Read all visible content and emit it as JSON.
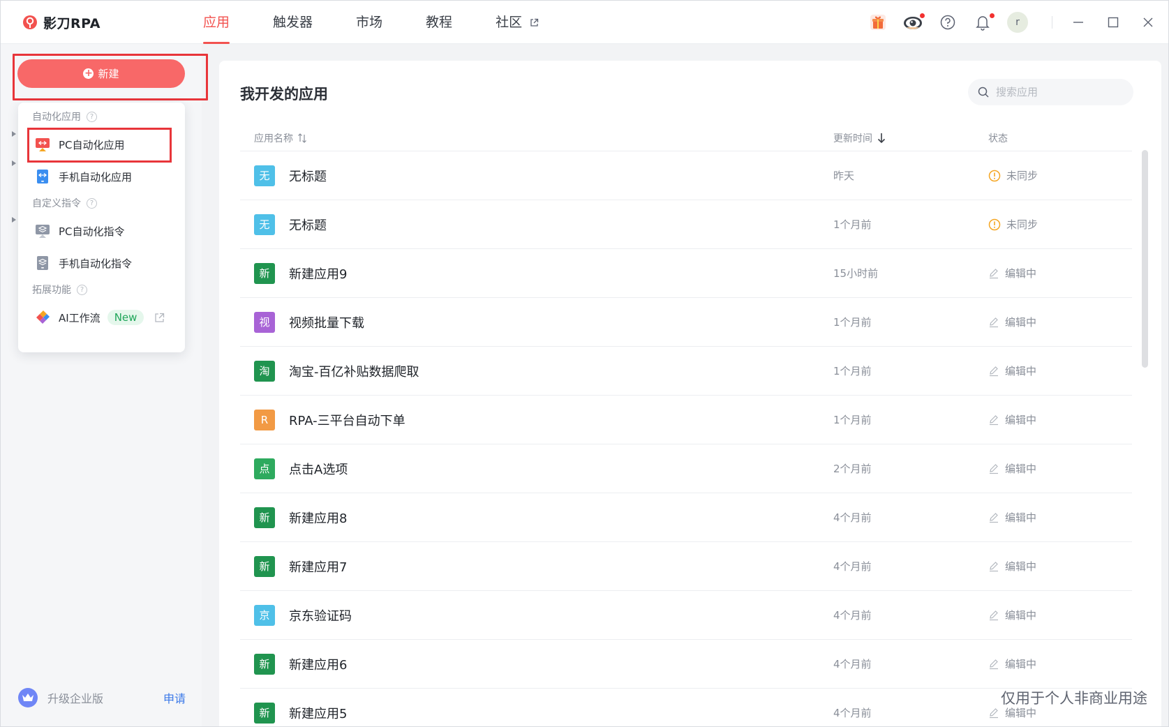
{
  "app": {
    "name": "影刀RPA",
    "brand_color": "#f2524f"
  },
  "nav": {
    "tabs": [
      {
        "label": "应用",
        "active": true
      },
      {
        "label": "触发器",
        "active": false
      },
      {
        "label": "市场",
        "active": false
      },
      {
        "label": "教程",
        "active": false
      },
      {
        "label": "社区",
        "active": false,
        "external": true
      }
    ]
  },
  "header": {
    "icons": [
      "gift-icon",
      "eye-icon",
      "help-icon",
      "bell-icon"
    ],
    "avatar_initial": "r"
  },
  "sidebar": {
    "new_button_label": "新建",
    "upgrade_text": "升级企业版",
    "upgrade_link": "申请"
  },
  "dropdown": {
    "sections": [
      {
        "title": "自动化应用",
        "items": [
          {
            "label": "PC自动化应用",
            "icon": "pc-app-icon"
          },
          {
            "label": "手机自动化应用",
            "icon": "mobile-app-icon"
          }
        ]
      },
      {
        "title": "自定义指令",
        "items": [
          {
            "label": "PC自动化指令",
            "icon": "pc-command-icon"
          },
          {
            "label": "手机自动化指令",
            "icon": "mobile-command-icon"
          }
        ]
      },
      {
        "title": "拓展功能",
        "items": [
          {
            "label": "AI工作流",
            "icon": "ai-workflow-icon",
            "badge": "New"
          }
        ]
      }
    ]
  },
  "main": {
    "title": "我开发的应用",
    "search_placeholder": "搜索应用",
    "columns": {
      "name": "应用名称",
      "time": "更新时间",
      "status": "状态"
    },
    "rows": [
      {
        "icon_char": "无",
        "icon_color": "#4fc0e8",
        "name": "无标题",
        "time": "昨天",
        "status": "未同步",
        "status_type": "warn"
      },
      {
        "icon_char": "无",
        "icon_color": "#4fc0e8",
        "name": "无标题",
        "time": "1个月前",
        "status": "未同步",
        "status_type": "warn"
      },
      {
        "icon_char": "新",
        "icon_color": "#20944f",
        "name": "新建应用9",
        "time": "15小时前",
        "status": "编辑中",
        "status_type": "edit"
      },
      {
        "icon_char": "视",
        "icon_color": "#a863d6",
        "name": "视频批量下载",
        "time": "1个月前",
        "status": "编辑中",
        "status_type": "edit"
      },
      {
        "icon_char": "淘",
        "icon_color": "#20944f",
        "name": "淘宝-百亿补贴数据爬取",
        "time": "1个月前",
        "status": "编辑中",
        "status_type": "edit"
      },
      {
        "icon_char": "R",
        "icon_color": "#f29a44",
        "name": "RPA-三平台自动下单",
        "time": "1个月前",
        "status": "编辑中",
        "status_type": "edit"
      },
      {
        "icon_char": "点",
        "icon_color": "#2eaa5e",
        "name": "点击A选项",
        "time": "2个月前",
        "status": "编辑中",
        "status_type": "edit"
      },
      {
        "icon_char": "新",
        "icon_color": "#20944f",
        "name": "新建应用8",
        "time": "4个月前",
        "status": "编辑中",
        "status_type": "edit"
      },
      {
        "icon_char": "新",
        "icon_color": "#20944f",
        "name": "新建应用7",
        "time": "4个月前",
        "status": "编辑中",
        "status_type": "edit"
      },
      {
        "icon_char": "京",
        "icon_color": "#4fc0e8",
        "name": "京东验证码",
        "time": "4个月前",
        "status": "编辑中",
        "status_type": "edit"
      },
      {
        "icon_char": "新",
        "icon_color": "#20944f",
        "name": "新建应用6",
        "time": "4个月前",
        "status": "编辑中",
        "status_type": "edit"
      },
      {
        "icon_char": "新",
        "icon_color": "#20944f",
        "name": "新建应用5",
        "time": "4个月前",
        "status": "编辑中",
        "status_type": "edit"
      }
    ]
  },
  "watermark": "仅用于个人非商业用途"
}
